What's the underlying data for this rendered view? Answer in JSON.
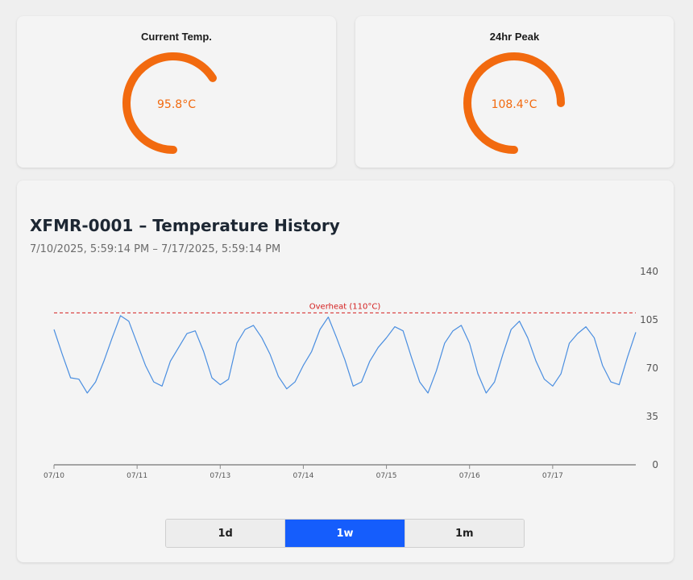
{
  "colors": {
    "gauge": "#f26a0f",
    "series": "#4a8ee0",
    "reference": "#d42020",
    "active_button": "#155dfc"
  },
  "gauges": [
    {
      "title": "Current Temp.",
      "value_label": "95.8°C",
      "value": 95.8,
      "arc_fraction": 0.66
    },
    {
      "title": "24hr Peak",
      "value_label": "108.4°C",
      "value": 108.4,
      "arc_fraction": 0.75
    }
  ],
  "history": {
    "title": "XFMR-0001 – Temperature History",
    "date_range": "7/10/2025, 5:59:14 PM – 7/17/2025, 5:59:14 PM"
  },
  "range_buttons": [
    {
      "label": "1d",
      "active": false
    },
    {
      "label": "1w",
      "active": true
    },
    {
      "label": "1m",
      "active": false
    }
  ],
  "chart_data": {
    "type": "line",
    "title": "",
    "xlabel": "",
    "ylabel": "",
    "ylim": [
      0,
      140
    ],
    "yticks": [
      0,
      35,
      70,
      105,
      140
    ],
    "y_axis_position": "right",
    "grid": false,
    "x_range_days": [
      0,
      7
    ],
    "xtick_positions_days": [
      0,
      1,
      2,
      3,
      4,
      5,
      6
    ],
    "xticks": [
      "07/10",
      "07/11",
      "07/13",
      "07/14",
      "07/15",
      "07/16",
      "07/17"
    ],
    "reference_line": {
      "value": 110,
      "label": "Overheat (110°C)"
    },
    "series": [
      {
        "x_days": [
          0.0,
          0.1,
          0.2,
          0.3,
          0.4,
          0.5,
          0.6,
          0.7,
          0.8,
          0.9,
          1.0,
          1.1,
          1.2,
          1.3,
          1.4,
          1.5,
          1.6,
          1.7,
          1.8,
          1.9,
          2.0,
          2.1,
          2.2,
          2.3,
          2.4,
          2.5,
          2.6,
          2.7,
          2.8,
          2.9,
          3.0,
          3.1,
          3.2,
          3.3,
          3.4,
          3.5,
          3.6,
          3.7,
          3.8,
          3.9,
          4.0,
          4.1,
          4.2,
          4.3,
          4.4,
          4.5,
          4.6,
          4.7,
          4.8,
          4.9,
          5.0,
          5.1,
          5.2,
          5.3,
          5.4,
          5.5,
          5.6,
          5.7,
          5.8,
          5.9,
          6.0,
          6.1,
          6.2,
          6.3,
          6.4,
          6.5,
          6.6,
          6.7,
          6.8,
          6.9,
          7.0
        ],
        "values": [
          98,
          80,
          63,
          62,
          52,
          60,
          75,
          92,
          108,
          104,
          88,
          72,
          60,
          57,
          75,
          85,
          95,
          97,
          82,
          63,
          58,
          62,
          88,
          98,
          101,
          92,
          80,
          64,
          55,
          60,
          72,
          82,
          98,
          107,
          92,
          76,
          57,
          60,
          75,
          85,
          92,
          100,
          97,
          78,
          60,
          52,
          68,
          88,
          97,
          101,
          88,
          66,
          52,
          60,
          80,
          98,
          104,
          92,
          75,
          62,
          57,
          66,
          88,
          95,
          100,
          92,
          72,
          60,
          58,
          78,
          96
        ]
      }
    ]
  }
}
